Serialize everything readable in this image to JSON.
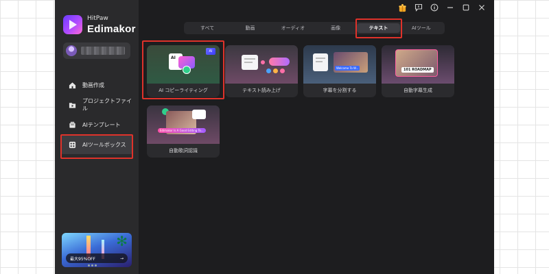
{
  "app": {
    "brand_sub": "HitPaw",
    "brand_name": "Edimakor"
  },
  "sidebar": {
    "items": [
      {
        "label": "動画作成",
        "icon": "home-icon"
      },
      {
        "label": "プロジェクトファイル",
        "icon": "folder-icon"
      },
      {
        "label": "AIテンプレート",
        "icon": "template-icon"
      },
      {
        "label": "AIツールボックス",
        "icon": "toolbox-icon",
        "active": true
      }
    ],
    "promo_text": "最大95%OFF",
    "promo_arrow": "→"
  },
  "tabs": [
    {
      "label": "すべて"
    },
    {
      "label": "動画"
    },
    {
      "label": "オーディオ"
    },
    {
      "label": "画像"
    },
    {
      "label": "テキスト",
      "active": true
    },
    {
      "label": "AIツール"
    }
  ],
  "cards": [
    {
      "label": "AI コピーライティング",
      "ai_badge": "AI",
      "thumb_text": "AI"
    },
    {
      "label": "テキスト読み上げ"
    },
    {
      "label": "字幕を分割する",
      "thumb_text": "Welcome To W..."
    },
    {
      "label": "自動字幕生成",
      "thumb_text": "101 ROADMAP"
    },
    {
      "label": "自動歌詞認識",
      "thumb_text": "Edimakor Is A Good Editing To..."
    }
  ],
  "colors": {
    "accent_red": "#e0322a",
    "active_tab_bg": "#3d3d42",
    "sidebar_bg": "#2a2a2c",
    "window_bg": "#1d1d1f"
  }
}
